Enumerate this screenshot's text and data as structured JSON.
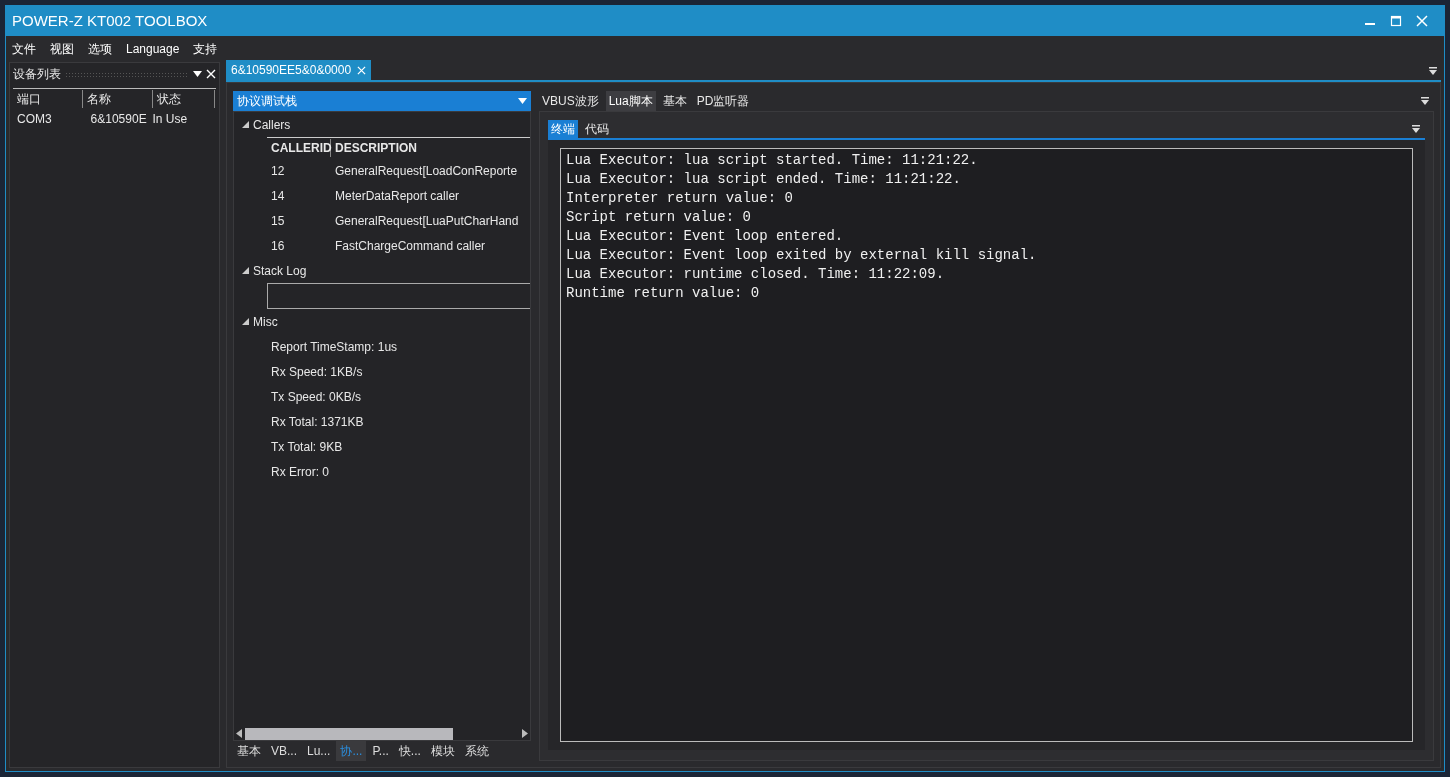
{
  "window": {
    "title": "POWER-Z KT002 TOOLBOX"
  },
  "menu": [
    "文件",
    "视图",
    "选项",
    "Language",
    "支持"
  ],
  "device_panel": {
    "title": "设备列表",
    "columns": [
      "端口",
      "名称",
      "状态"
    ],
    "rows": [
      {
        "cells": [
          "COM3",
          "6&10590E",
          "In Use"
        ]
      }
    ]
  },
  "document_tab": {
    "label": "6&10590EE5&0&0000",
    "selected": true
  },
  "left_pane": {
    "dropdown": "协议调试栈",
    "sections": [
      {
        "kind": "table",
        "title": "Callers",
        "expanded": true,
        "columns": [
          "CALLERID",
          "DESCRIPTION"
        ],
        "rows": [
          [
            "12",
            "GeneralRequest[LoadConReporte"
          ],
          [
            "14",
            "MeterDataReport caller"
          ],
          [
            "15",
            "GeneralRequest[LuaPutCharHand"
          ],
          [
            "16",
            "FastChargeCommand caller"
          ]
        ]
      },
      {
        "kind": "field",
        "title": "Stack Log",
        "expanded": true
      },
      {
        "kind": "list",
        "title": "Misc",
        "expanded": true,
        "items": [
          "Report TimeStamp: 1us",
          "Rx Speed: 1KB/s",
          "Tx Speed: 0KB/s",
          "Rx Total: 1371KB",
          "Tx Total: 9KB",
          "Rx Error: 0"
        ]
      }
    ],
    "bottom_tabs": [
      {
        "label": "基本",
        "selected": false
      },
      {
        "label": "VB...",
        "selected": false
      },
      {
        "label": "Lu...",
        "selected": false
      },
      {
        "label": "协...",
        "selected": true
      },
      {
        "label": "P...",
        "selected": false
      },
      {
        "label": "快...",
        "selected": false
      },
      {
        "label": "模块",
        "selected": false
      },
      {
        "label": "系统",
        "selected": false
      }
    ]
  },
  "right_pane": {
    "tabs": [
      {
        "label": "VBUS波形",
        "selected": false
      },
      {
        "label": "Lua脚本",
        "selected": true
      },
      {
        "label": "基本",
        "selected": false
      },
      {
        "label": "PD监听器",
        "selected": false
      }
    ],
    "inner_tabs": [
      {
        "label": "终端",
        "selected": true
      },
      {
        "label": "代码",
        "selected": false
      }
    ],
    "terminal": [
      "Lua Executor: lua script started. Time: 11:21:22.",
      "Lua Executor: lua script ended. Time: 11:21:22.",
      "Interpreter return value: 0",
      "Script return value: 0",
      "Lua Executor: Event loop entered.",
      "Lua Executor: Event loop exited by external kill signal.",
      "Lua Executor: runtime closed. Time: 11:22:09.",
      "Runtime return value: 0"
    ]
  }
}
